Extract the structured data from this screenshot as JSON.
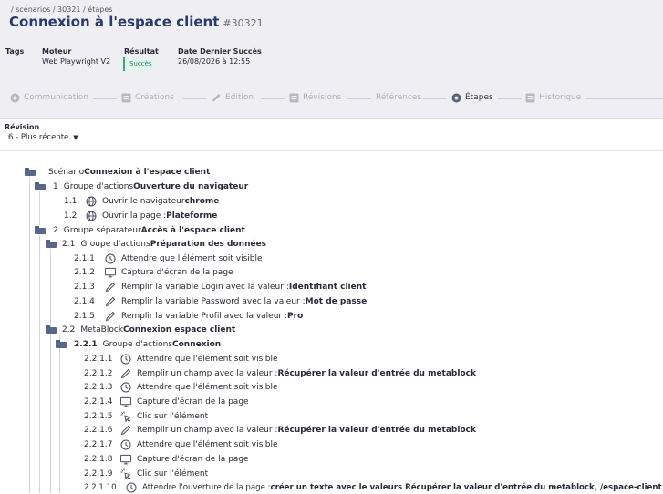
{
  "header": {
    "breadcrumb": "/ scénarios / 30321 / étapes",
    "title": "Connexion à l'espace client",
    "title_id": "#30321",
    "tags_label": "Tags",
    "moteur_label": "Moteur",
    "moteur_value": "Web Playwright V2",
    "resultat_label": "Résultat",
    "resultat_value": "Succès",
    "date_label": "Date Dernier Succès",
    "date_value": "26/08/2026 à 12:55"
  },
  "tabs": [
    {
      "label": "Communication",
      "icon": "communication-icon",
      "active": false
    },
    {
      "label": "Créations",
      "icon": "creations-icon",
      "active": false
    },
    {
      "label": "Edition",
      "icon": "edit-icon",
      "active": false
    },
    {
      "label": "Révisions",
      "icon": "revisions-icon",
      "active": false
    },
    {
      "label": "Références",
      "icon": "",
      "active": false
    },
    {
      "label": "Étapes",
      "icon": "steps-icon",
      "active": true
    },
    {
      "label": "Historique",
      "icon": "history-icon",
      "active": false
    }
  ],
  "revision": {
    "label": "Révision",
    "selected": "6 - Plus récente"
  },
  "tree": [
    {
      "num": "",
      "prefix": "Scénario ",
      "bold": "Connexion à l'espace client",
      "icon": "folder-icon"
    },
    {
      "num": "1",
      "prefix": "Groupe d'actions ",
      "bold": "Ouverture du navigateur",
      "icon": "folder-icon"
    },
    {
      "num": "1.1",
      "prefix": "Ouvrir le navigateur ",
      "bold": "chrome",
      "icon": "globe-icon"
    },
    {
      "num": "1.2",
      "prefix": "Ouvrir la page : ",
      "bold": "Plateforme",
      "icon": "globe-icon"
    },
    {
      "num": "2",
      "prefix": "Groupe séparateur ",
      "bold": "Accès à l'espace client",
      "icon": "folder-icon"
    },
    {
      "num": "2.1",
      "prefix": "Groupe d'actions ",
      "bold": "Préparation des données",
      "icon": "folder-icon"
    },
    {
      "num": "2.1.1",
      "prefix": "Attendre que l'élément soit visible",
      "bold": "",
      "icon": "clock-icon"
    },
    {
      "num": "2.1.2",
      "prefix": "Capture d'écran de la page",
      "bold": "",
      "icon": "monitor-icon"
    },
    {
      "num": "2.1.3",
      "prefix": "Remplir la variable Login avec la valeur : ",
      "bold": "Identifiant client",
      "icon": "pencil-icon"
    },
    {
      "num": "2.1.4",
      "prefix": "Remplir la variable Password avec la valeur : ",
      "bold": "Mot de passe",
      "icon": "pencil-icon"
    },
    {
      "num": "2.1.5",
      "prefix": "Remplir la variable Profil avec la valeur : ",
      "bold": "Pro",
      "icon": "pencil-icon"
    },
    {
      "num": "2.2",
      "prefix": "MetaBlock ",
      "bold": "Connexion espace client",
      "icon": "folder-icon"
    },
    {
      "num": "2.2.1",
      "prefix": "Groupe d'actions ",
      "bold": "Connexion",
      "icon": "folder-icon"
    },
    {
      "num": "2.2.1.1",
      "prefix": "Attendre que l'élément soit visible",
      "bold": "",
      "icon": "clock-icon"
    },
    {
      "num": "2.2.1.2",
      "prefix": "Remplir un champ avec la valeur : ",
      "bold": "Récupérer la valeur d'entrée du metablock",
      "icon": "pencil-icon"
    },
    {
      "num": "2.2.1.3",
      "prefix": "Attendre que l'élément soit visible",
      "bold": "",
      "icon": "clock-icon"
    },
    {
      "num": "2.2.1.4",
      "prefix": "Capture d'écran de la page",
      "bold": "",
      "icon": "monitor-icon"
    },
    {
      "num": "2.2.1.5",
      "prefix": "Clic sur l'élément",
      "bold": "",
      "icon": "click-icon"
    },
    {
      "num": "2.2.1.6",
      "prefix": "Remplir un champ avec la valeur : ",
      "bold": "Récupérer la valeur d'entrée du metablock",
      "icon": "pencil-icon"
    },
    {
      "num": "2.2.1.7",
      "prefix": "Attendre que l'élément soit visible",
      "bold": "",
      "icon": "clock-icon"
    },
    {
      "num": "2.2.1.8",
      "prefix": "Capture d'écran de la page",
      "bold": "",
      "icon": "monitor-icon"
    },
    {
      "num": "2.2.1.9",
      "prefix": "Clic sur l'élément",
      "bold": "",
      "icon": "click-icon"
    },
    {
      "num": "2.2.1.10",
      "prefix": "Attendre l'ouverture de la page : ",
      "bold": "créer un texte avec le valeurs Récupérer la valeur d'entrée du metablock, /espace-client",
      "icon": "clock-icon"
    }
  ]
}
